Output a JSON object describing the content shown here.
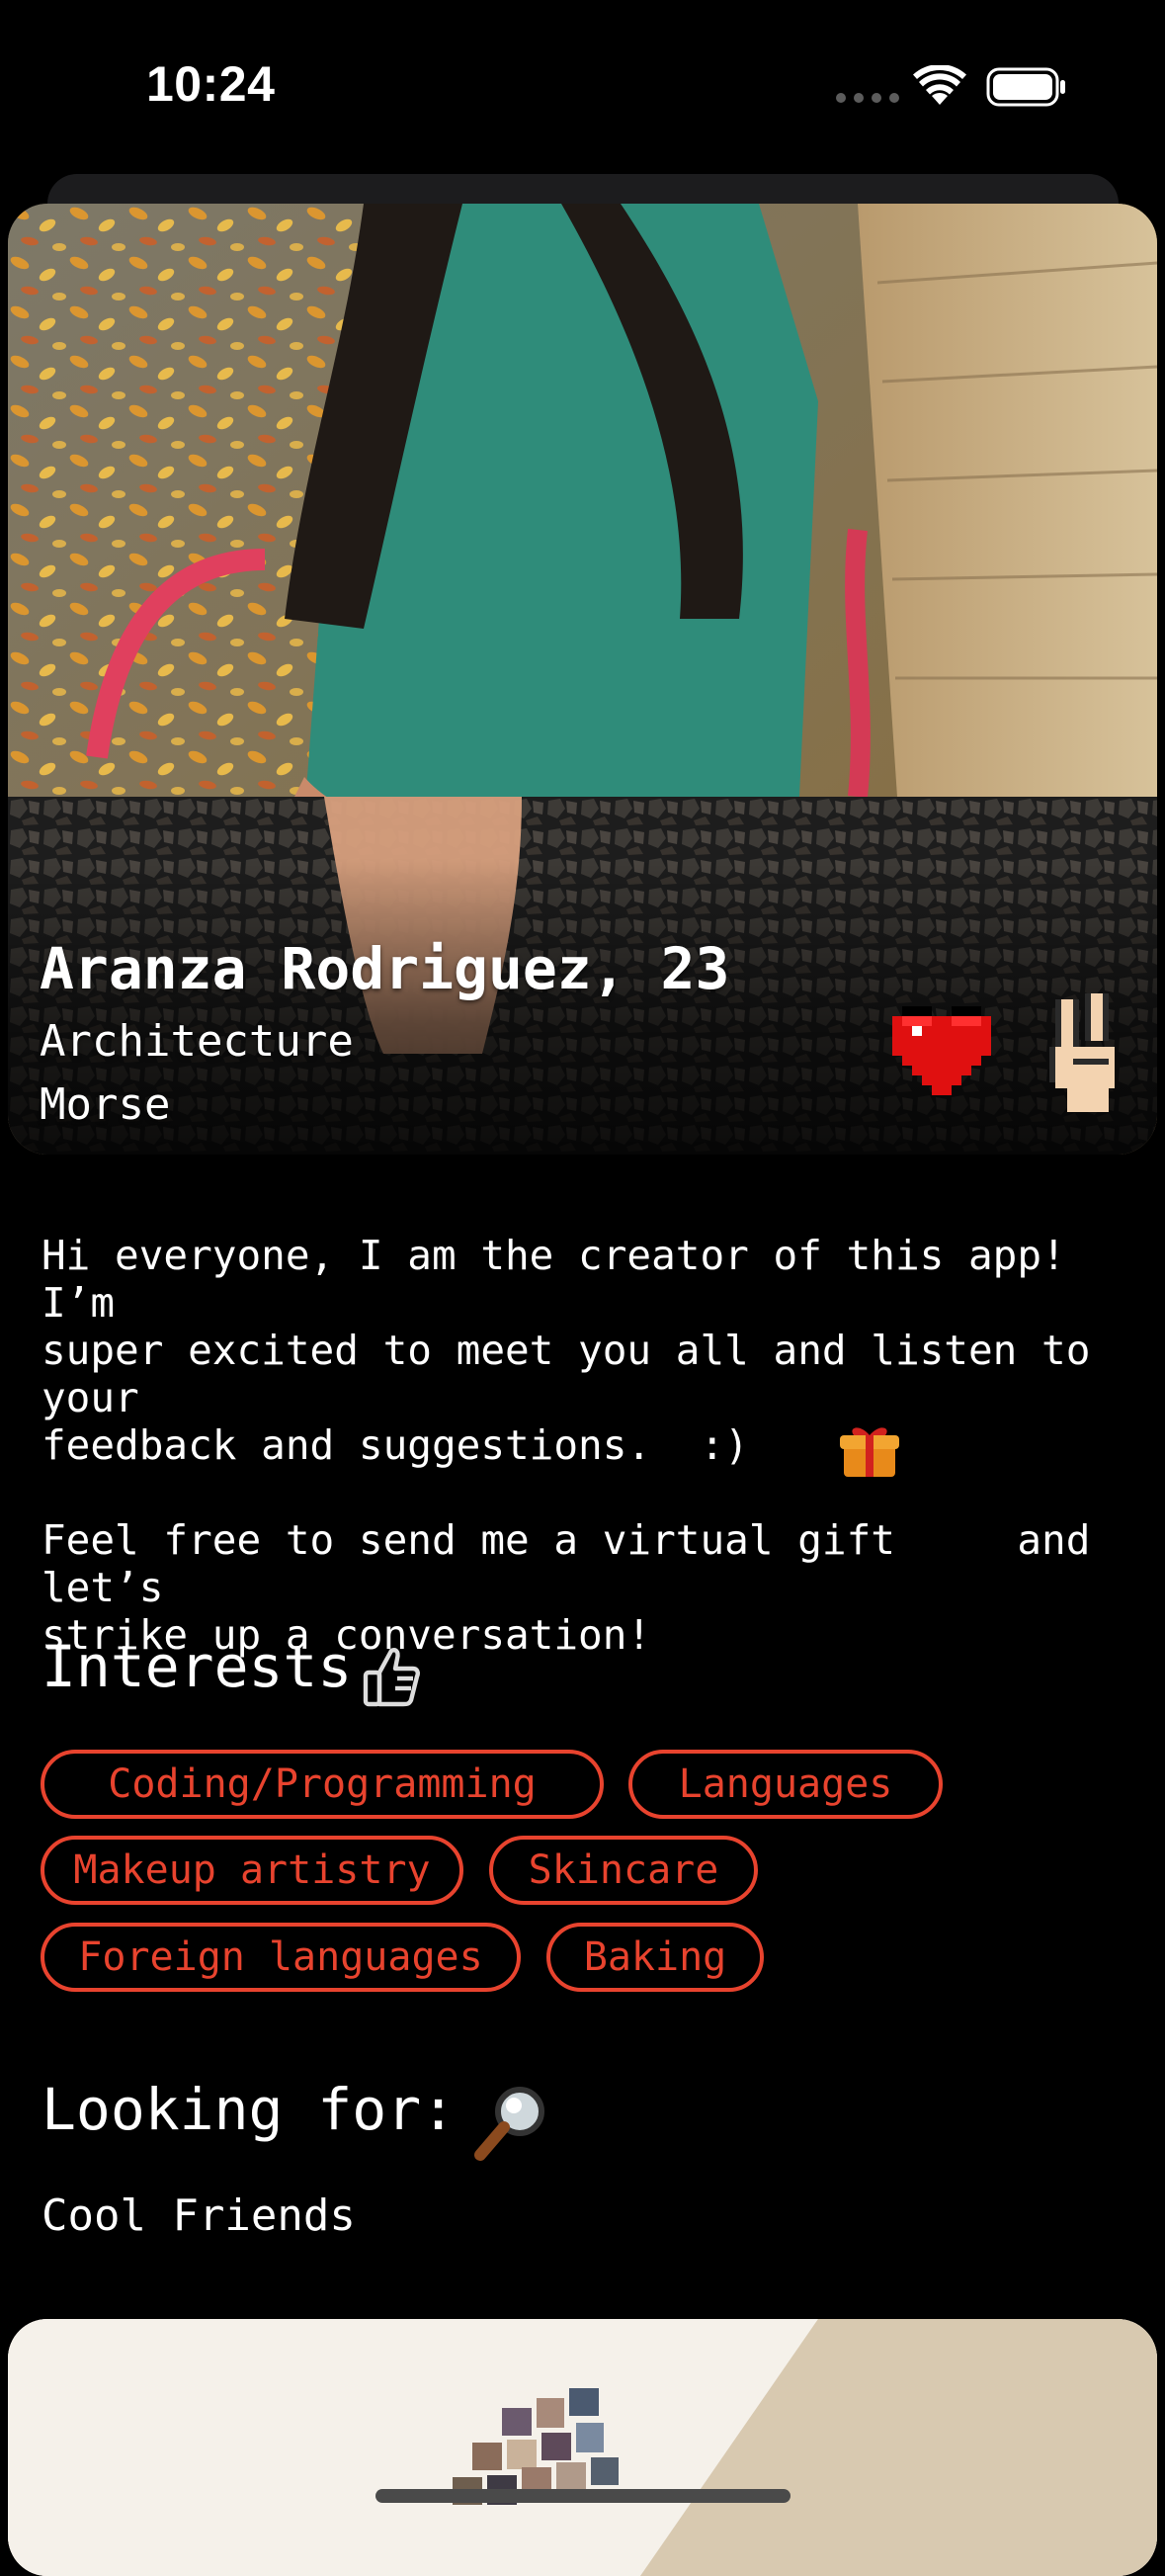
{
  "status_bar": {
    "time": "10:24",
    "icons": [
      "cellular-dots-icon",
      "wifi-icon",
      "battery-icon"
    ]
  },
  "profile": {
    "name_line": "Aranza Rodriguez, 23",
    "major": "Architecture",
    "college": "Morse",
    "actions": [
      "heart-icon",
      "peace-hand-icon"
    ]
  },
  "bio": {
    "paragraph1": "Hi everyone, I am the creator of this app! I’m\nsuper excited to meet you all and listen to your\nfeedback and suggestions.  :)",
    "paragraph2": "Feel free to send me a virtual gift     and let’s\nstrike up a conversation!",
    "inline_icon": "gift-icon"
  },
  "interests": {
    "title": "Interests",
    "title_icon": "thumbs-up-icon",
    "chips": [
      "Coding/Programming",
      "Languages",
      "Makeup artistry",
      "Skincare",
      "Foreign languages",
      "Baking"
    ]
  },
  "looking_for": {
    "title": "Looking for:",
    "title_icon": "magnifier-icon",
    "value": "Cool Friends"
  },
  "colors": {
    "background": "#000000",
    "text": "#ffffff",
    "chip_accent": "#e8432e",
    "heart": "#e01010"
  }
}
